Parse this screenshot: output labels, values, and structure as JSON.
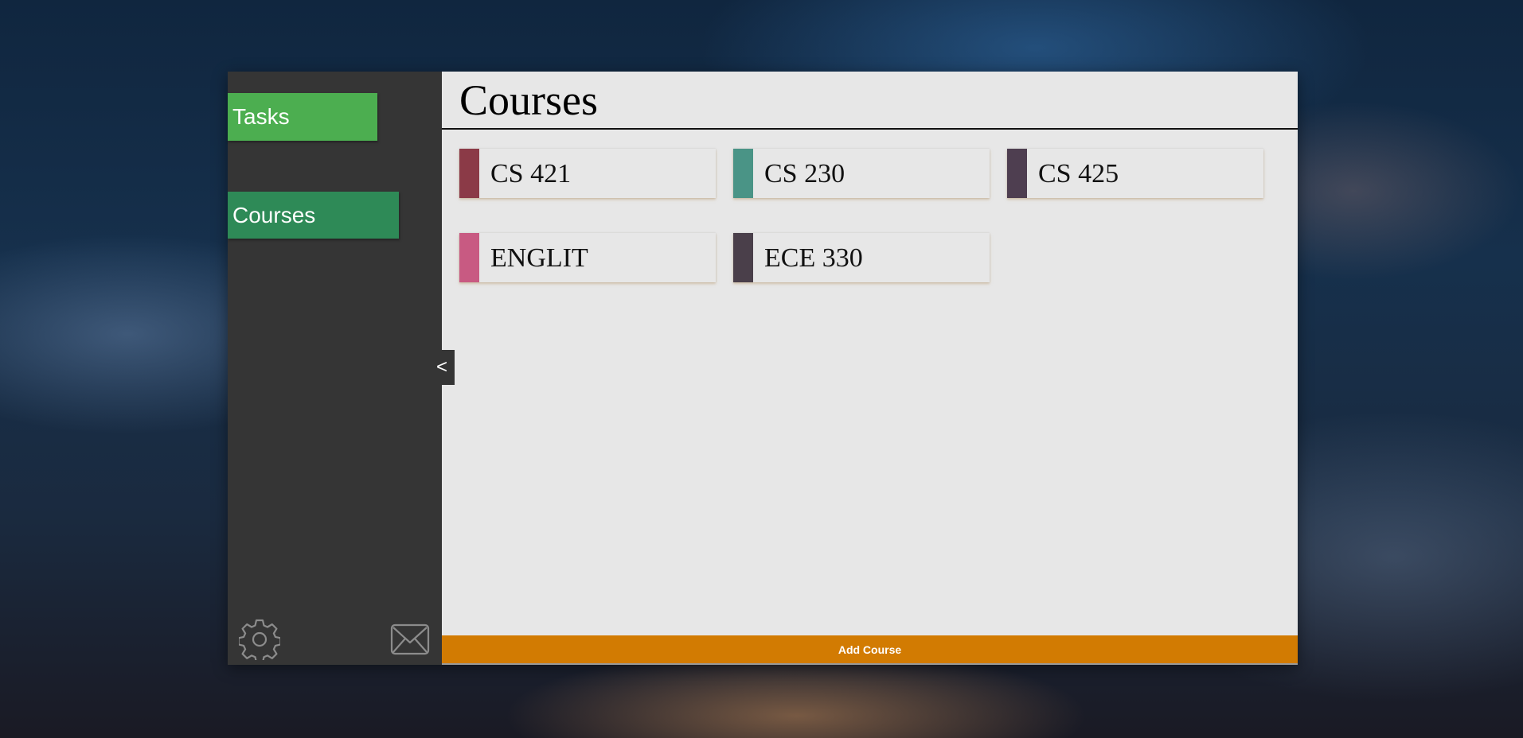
{
  "sidebar": {
    "items": [
      {
        "label": "Tasks",
        "color": "#4cae50"
      },
      {
        "label": "Courses",
        "color": "#2e8a57"
      }
    ],
    "settings_icon": "gear-icon",
    "mail_icon": "envelope-icon",
    "collapse_label": "<"
  },
  "main": {
    "title": "Courses",
    "courses": [
      {
        "name": "CS 421",
        "color": "#8b3a47"
      },
      {
        "name": "CS 230",
        "color": "#4a9486"
      },
      {
        "name": "CS 425",
        "color": "#4e3e50"
      },
      {
        "name": "ENGLIT",
        "color": "#c85a82"
      },
      {
        "name": "ECE 330",
        "color": "#4a3f4a"
      }
    ],
    "add_button_label": "Add Course",
    "add_button_color": "#d27b02"
  }
}
